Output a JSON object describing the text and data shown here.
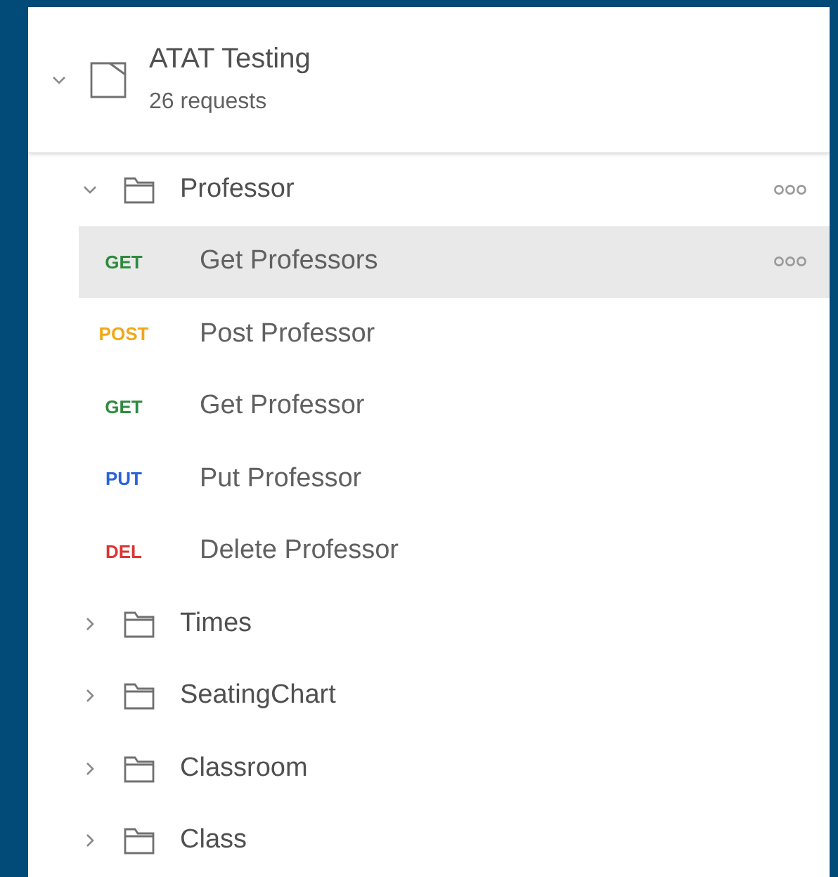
{
  "collection": {
    "name": "ATAT Testing",
    "count": "26 requests",
    "expanded": true
  },
  "folders": [
    {
      "name": "Professor",
      "expanded": true,
      "menu_visible": true,
      "children": [
        {
          "method": "GET",
          "color": "#2e8b3e",
          "name": "Get Professors",
          "selected": true,
          "menu_visible": true
        },
        {
          "method": "POST",
          "color": "#f0a818",
          "name": "Post Professor",
          "selected": false,
          "menu_visible": false
        },
        {
          "method": "GET",
          "color": "#2e8b3e",
          "name": "Get Professor",
          "selected": false,
          "menu_visible": false
        },
        {
          "method": "PUT",
          "color": "#2a63d6",
          "name": "Put Professor",
          "selected": false,
          "menu_visible": false
        },
        {
          "method": "DEL",
          "color": "#dd3333",
          "name": "Delete Professor",
          "selected": false,
          "menu_visible": false
        }
      ]
    },
    {
      "name": "Times",
      "expanded": false,
      "menu_visible": false
    },
    {
      "name": "SeatingChart",
      "expanded": false,
      "menu_visible": false
    },
    {
      "name": "Classroom",
      "expanded": false,
      "menu_visible": false
    },
    {
      "name": "Class",
      "expanded": false,
      "menu_visible": false
    }
  ]
}
